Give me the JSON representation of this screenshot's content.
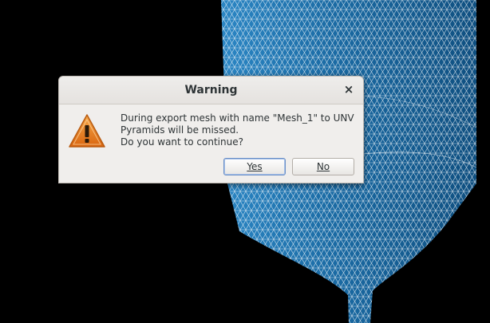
{
  "dialog": {
    "title": "Warning",
    "close_glyph": "×",
    "icon": "warning-triangle-icon",
    "message": [
      "During export mesh with name \"Mesh_1\" to UNV",
      "Pyramids will be missed.",
      "Do you want to continue?"
    ],
    "buttons": {
      "yes": "Yes",
      "no": "No"
    }
  },
  "colors": {
    "background": "#000000",
    "mesh_fill": "#1f6ea6",
    "mesh_lines": "#ffffff",
    "dialog_bg": "#f0eeec",
    "warning_orange": "#e87e1c"
  }
}
